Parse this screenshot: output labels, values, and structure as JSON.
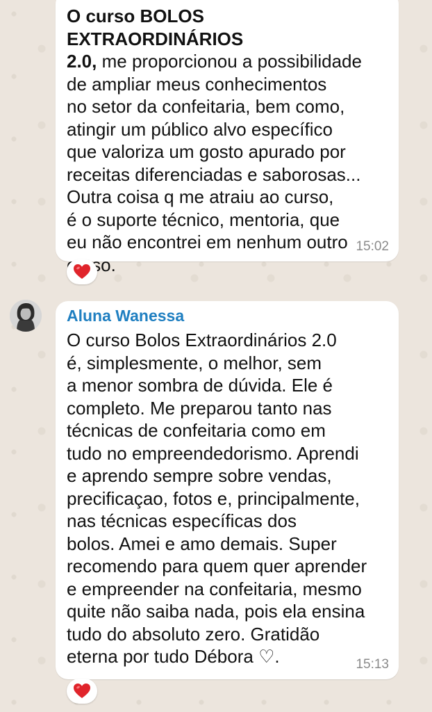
{
  "message1": {
    "bold_lead": "O curso  BOLOS EXTRAORDINÁRIOS\n2.0,",
    "body": " me proporcionou a possibilidade\nde ampliar meus conhecimentos\nno setor da confeitaria, bem como,\natingir um público alvo específico\nque valoriza um gosto apurado por\nreceitas diferenciadas e saborosas...\nOutra coisa q me atraiu ao curso,\né o suporte técnico, mentoria, que\neu não encontrei em nenhum outro\ncurso.",
    "time": "15:02",
    "reaction": "heart-emoji"
  },
  "message2": {
    "sender": "Aluna Wanessa",
    "body": "O curso Bolos Extraordinários 2.0\né,  simplesmente,  o melhor,  sem\na menor sombra de dúvida. Ele é\ncompleto.  Me preparou tanto nas\ntécnicas de confeitaria como em\ntudo no empreendedorismo.  Aprendi\ne aprendo sempre sobre vendas,\nprecificaçao, fotos e, principalmente,\nnas técnicas específicas dos\nbolos.  Amei e amo demais. Super\nrecomendo para quem quer aprender\ne empreender na confeitaria, mesmo\nquite não saiba nada, pois ela ensina\ntudo do absoluto zero. Gratidão\neterna por tudo Débora ♡.",
    "time": "15:13",
    "reaction": "heart-emoji"
  },
  "colors": {
    "wallpaper": "#ece5dd",
    "bubble": "#ffffff",
    "sender_name": "#1f7fc1",
    "timestamp": "#8a8a8a",
    "heart": "#e0242b"
  }
}
